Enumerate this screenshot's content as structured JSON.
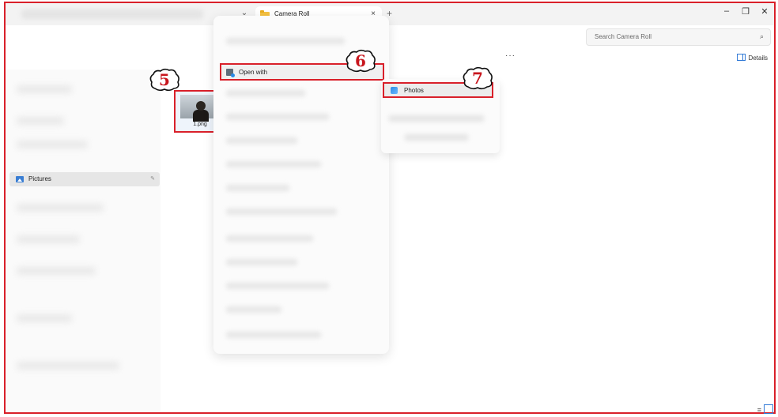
{
  "window": {
    "tab_title": "Camera Roll",
    "tab_close": "×",
    "tab_add": "+",
    "chevron": "⌄",
    "minimize": "–",
    "restore": "❐",
    "close": "✕"
  },
  "search": {
    "placeholder": "Search Camera Roll",
    "icon": "⌕"
  },
  "commandbar": {
    "more": "···",
    "details_label": "Details"
  },
  "sidebar": {
    "pictures_label": "Pictures",
    "pin": "✎"
  },
  "file": {
    "name": "1.png"
  },
  "context_menu": {
    "open_with": "Open with"
  },
  "submenu": {
    "photos": "Photos"
  },
  "steps": {
    "step5": "5",
    "step6": "6",
    "step7": "7"
  },
  "view": {
    "list_icon": "≡"
  },
  "colors": {
    "highlight": "#d9202a",
    "accent": "#3079d6"
  }
}
